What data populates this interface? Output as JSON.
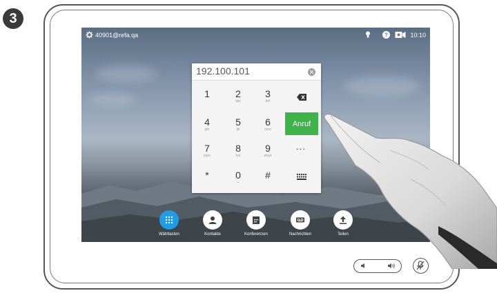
{
  "step": "3",
  "status": {
    "account": "40901@refa.qa",
    "time": "10:10",
    "icons": [
      "settings-icon",
      "light-bulb-icon",
      "help-icon",
      "camera-self-view-icon"
    ]
  },
  "dialer": {
    "value": "192.100.101",
    "keys": [
      {
        "digit": "1",
        "letters": ""
      },
      {
        "digit": "2",
        "letters": "abc"
      },
      {
        "digit": "3",
        "letters": "def"
      },
      {
        "digit": "4",
        "letters": "ghi"
      },
      {
        "digit": "5",
        "letters": "jkl"
      },
      {
        "digit": "6",
        "letters": "mno"
      },
      {
        "digit": "7",
        "letters": "pqrs"
      },
      {
        "digit": "8",
        "letters": "tuv"
      },
      {
        "digit": "9",
        "letters": "wxyz"
      },
      {
        "digit": "*",
        "letters": "."
      },
      {
        "digit": "0",
        "letters": "+"
      },
      {
        "digit": "#",
        "letters": ""
      }
    ],
    "call_label": "Anruf",
    "more_label": "...",
    "side_icons": [
      "backspace-icon",
      "more-icon",
      "keyboard-icon"
    ]
  },
  "bottom_nav": [
    {
      "label": "Wähltasten",
      "icon": "dialpad-icon",
      "active": true
    },
    {
      "label": "Kontakte",
      "icon": "contact-icon",
      "active": false
    },
    {
      "label": "Konferenzen",
      "icon": "calendar-icon",
      "active": false
    },
    {
      "label": "Nachrichten",
      "icon": "voicemail-icon",
      "active": false
    },
    {
      "label": "Teilen",
      "icon": "share-icon",
      "active": false
    }
  ],
  "hardware": {
    "volume_icons": [
      "volume-down-icon",
      "volume-up-icon"
    ],
    "mute_icon": "microphone-mute-icon"
  },
  "colors": {
    "call": "#3db34a",
    "active_nav": "#1f9ce6"
  }
}
